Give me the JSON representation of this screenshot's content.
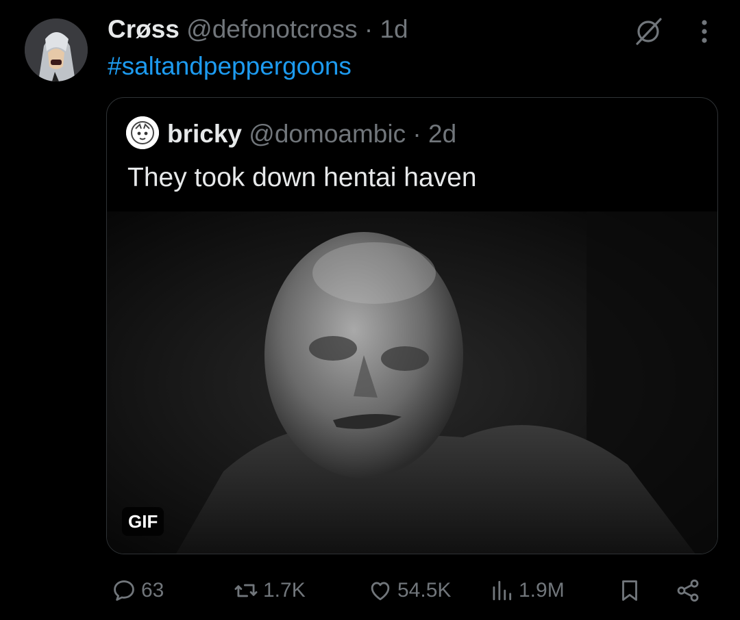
{
  "tweet": {
    "author_name": "Crøss",
    "author_handle": "@defonotcross",
    "separator": "·",
    "time": "1d",
    "text": "#saltandpeppergoons"
  },
  "quoted": {
    "author_name": "bricky",
    "author_handle": "@domoambic",
    "separator": "·",
    "time": "2d",
    "text": "They took down hentai haven",
    "media_badge": "GIF"
  },
  "actions": {
    "replies": "63",
    "retweets": "1.7K",
    "likes": "54.5K",
    "views": "1.9M"
  },
  "colors": {
    "background": "#000000",
    "text": "#e7e9ea",
    "muted": "#71767b",
    "link": "#1d9bf0",
    "border": "#2f3336"
  },
  "icons": [
    "grok-icon",
    "more-icon",
    "reply-icon",
    "retweet-icon",
    "like-icon",
    "views-icon",
    "bookmark-icon",
    "share-icon"
  ]
}
